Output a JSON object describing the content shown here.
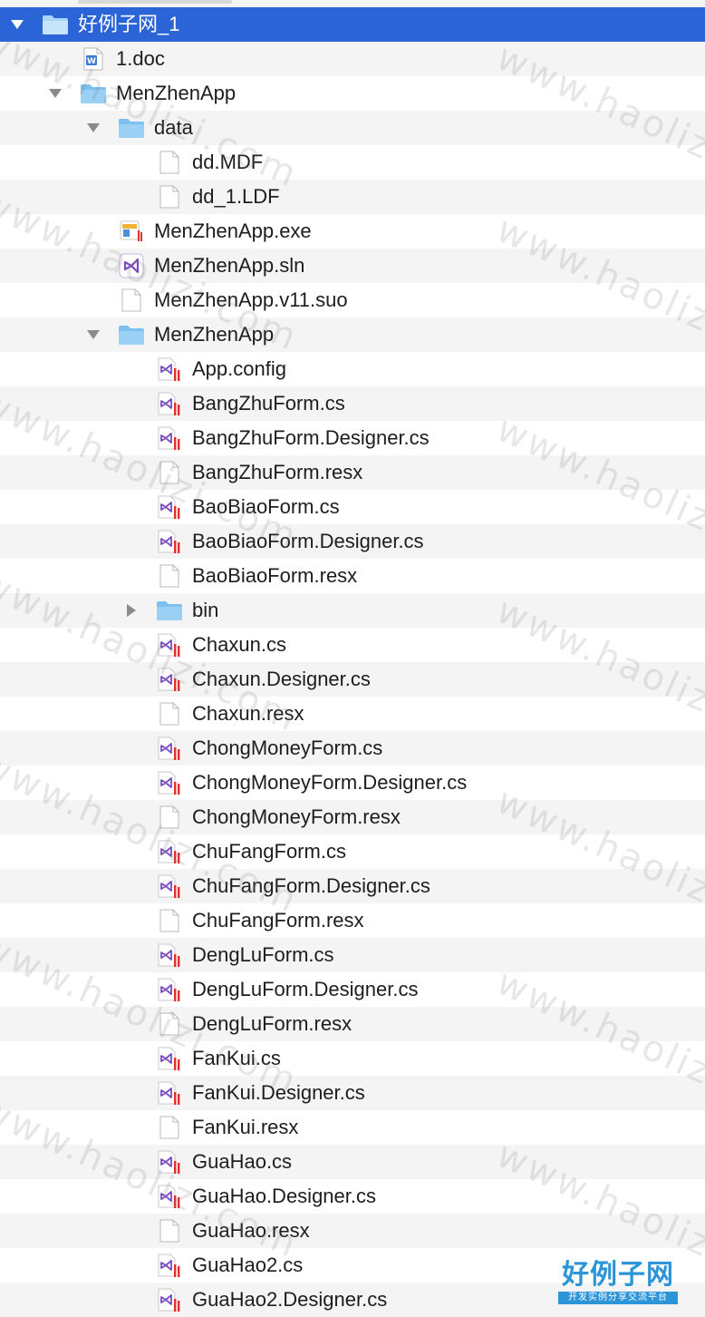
{
  "colors": {
    "selection": "#2a64d7",
    "stripe": "#f4f4f5",
    "folder": "#7ec0ef",
    "vs_purple": "#7a4cc0",
    "vs_red": "#e0302b",
    "watermark": "#787878",
    "logo": "#2c95d7"
  },
  "tree": [
    {
      "name": "好例子网_1",
      "depth": 0,
      "type": "folder",
      "icon": "folder-icon",
      "disclosure": "expanded",
      "selected": true
    },
    {
      "name": "1.doc",
      "depth": 1,
      "type": "doc",
      "icon": "word-document-icon"
    },
    {
      "name": "MenZhenApp",
      "depth": 1,
      "type": "folder",
      "icon": "folder-icon",
      "disclosure": "expanded"
    },
    {
      "name": "data",
      "depth": 2,
      "type": "folder",
      "icon": "folder-icon",
      "disclosure": "expanded"
    },
    {
      "name": "dd.MDF",
      "depth": 3,
      "type": "file",
      "icon": "blank-file-icon"
    },
    {
      "name": "dd_1.LDF",
      "depth": 3,
      "type": "file",
      "icon": "blank-file-icon"
    },
    {
      "name": "MenZhenApp.exe",
      "depth": 2,
      "type": "exe",
      "icon": "executable-icon"
    },
    {
      "name": "MenZhenApp.sln",
      "depth": 2,
      "type": "sln",
      "icon": "visual-studio-solution-icon"
    },
    {
      "name": "MenZhenApp.v11.suo",
      "depth": 2,
      "type": "file",
      "icon": "blank-file-icon"
    },
    {
      "name": "MenZhenApp",
      "depth": 2,
      "type": "folder",
      "icon": "folder-icon",
      "disclosure": "expanded"
    },
    {
      "name": "App.config",
      "depth": 3,
      "type": "vs",
      "icon": "visual-studio-file-icon"
    },
    {
      "name": "BangZhuForm.cs",
      "depth": 3,
      "type": "vs",
      "icon": "visual-studio-file-icon"
    },
    {
      "name": "BangZhuForm.Designer.cs",
      "depth": 3,
      "type": "vs",
      "icon": "visual-studio-file-icon"
    },
    {
      "name": "BangZhuForm.resx",
      "depth": 3,
      "type": "file",
      "icon": "blank-file-icon"
    },
    {
      "name": "BaoBiaoForm.cs",
      "depth": 3,
      "type": "vs",
      "icon": "visual-studio-file-icon"
    },
    {
      "name": "BaoBiaoForm.Designer.cs",
      "depth": 3,
      "type": "vs",
      "icon": "visual-studio-file-icon"
    },
    {
      "name": "BaoBiaoForm.resx",
      "depth": 3,
      "type": "file",
      "icon": "blank-file-icon"
    },
    {
      "name": "bin",
      "depth": 3,
      "type": "folder",
      "icon": "folder-icon",
      "disclosure": "collapsed"
    },
    {
      "name": "Chaxun.cs",
      "depth": 3,
      "type": "vs",
      "icon": "visual-studio-file-icon"
    },
    {
      "name": "Chaxun.Designer.cs",
      "depth": 3,
      "type": "vs",
      "icon": "visual-studio-file-icon"
    },
    {
      "name": "Chaxun.resx",
      "depth": 3,
      "type": "file",
      "icon": "blank-file-icon"
    },
    {
      "name": "ChongMoneyForm.cs",
      "depth": 3,
      "type": "vs",
      "icon": "visual-studio-file-icon"
    },
    {
      "name": "ChongMoneyForm.Designer.cs",
      "depth": 3,
      "type": "vs",
      "icon": "visual-studio-file-icon"
    },
    {
      "name": "ChongMoneyForm.resx",
      "depth": 3,
      "type": "file",
      "icon": "blank-file-icon"
    },
    {
      "name": "ChuFangForm.cs",
      "depth": 3,
      "type": "vs",
      "icon": "visual-studio-file-icon"
    },
    {
      "name": "ChuFangForm.Designer.cs",
      "depth": 3,
      "type": "vs",
      "icon": "visual-studio-file-icon"
    },
    {
      "name": "ChuFangForm.resx",
      "depth": 3,
      "type": "file",
      "icon": "blank-file-icon"
    },
    {
      "name": "DengLuForm.cs",
      "depth": 3,
      "type": "vs",
      "icon": "visual-studio-file-icon"
    },
    {
      "name": "DengLuForm.Designer.cs",
      "depth": 3,
      "type": "vs",
      "icon": "visual-studio-file-icon"
    },
    {
      "name": "DengLuForm.resx",
      "depth": 3,
      "type": "file",
      "icon": "blank-file-icon"
    },
    {
      "name": "FanKui.cs",
      "depth": 3,
      "type": "vs",
      "icon": "visual-studio-file-icon"
    },
    {
      "name": "FanKui.Designer.cs",
      "depth": 3,
      "type": "vs",
      "icon": "visual-studio-file-icon"
    },
    {
      "name": "FanKui.resx",
      "depth": 3,
      "type": "file",
      "icon": "blank-file-icon"
    },
    {
      "name": "GuaHao.cs",
      "depth": 3,
      "type": "vs",
      "icon": "visual-studio-file-icon"
    },
    {
      "name": "GuaHao.Designer.cs",
      "depth": 3,
      "type": "vs",
      "icon": "visual-studio-file-icon"
    },
    {
      "name": "GuaHao.resx",
      "depth": 3,
      "type": "file",
      "icon": "blank-file-icon"
    },
    {
      "name": "GuaHao2.cs",
      "depth": 3,
      "type": "vs",
      "icon": "visual-studio-file-icon"
    },
    {
      "name": "GuaHao2.Designer.cs",
      "depth": 3,
      "type": "vs",
      "icon": "visual-studio-file-icon"
    }
  ],
  "watermark": {
    "text": "www.haolizi.com"
  },
  "logo": {
    "title": "好例子网",
    "subtitle": "开发实例分享交流平台"
  }
}
